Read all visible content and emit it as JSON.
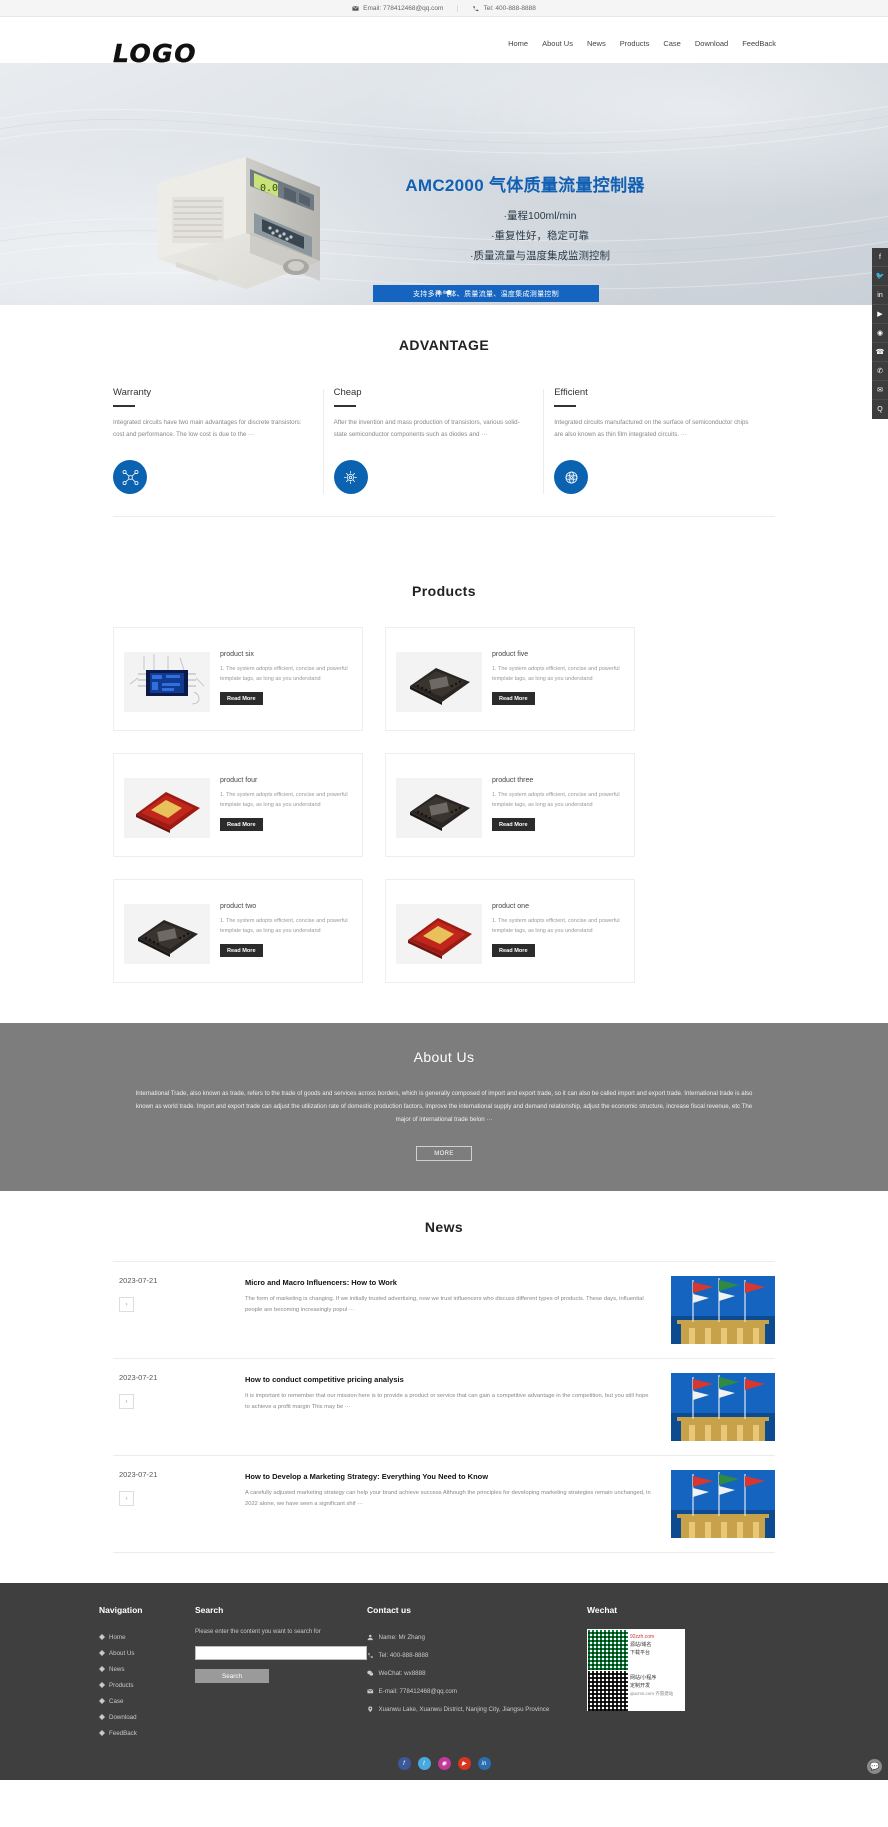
{
  "topbar": {
    "email_label": "Email: 778412468@qq.com",
    "tel_label": "Tel: 400-888-8888",
    "email_icon": "envelope-icon",
    "tel_icon": "phone-icon"
  },
  "header": {
    "logo_text": "LOGO",
    "nav": [
      {
        "label": "Home"
      },
      {
        "label": "About Us"
      },
      {
        "label": "News"
      },
      {
        "label": "Products"
      },
      {
        "label": "Case"
      },
      {
        "label": "Download"
      },
      {
        "label": "FeedBack"
      }
    ]
  },
  "hero": {
    "title": "AMC2000 气体质量流量控制器",
    "bullets": [
      "·量程100ml/min",
      "·重复性好，稳定可靠",
      "·质量流量与温度集成监测控制"
    ],
    "cta_label": "支持多种气体、质量流量、温度集成测量控制",
    "accent_color": "#1260b4",
    "cta_bg": "#1565c0",
    "slide_count": 2,
    "active_slide": 2
  },
  "social_rail": [
    {
      "name": "facebook",
      "glyph": "f"
    },
    {
      "name": "twitter",
      "glyph": "🐦"
    },
    {
      "name": "linkedin",
      "glyph": "in"
    },
    {
      "name": "youtube",
      "glyph": "▶"
    },
    {
      "name": "instagram",
      "glyph": "◉"
    },
    {
      "name": "phone",
      "glyph": "☎"
    },
    {
      "name": "whatsapp",
      "glyph": "✆"
    },
    {
      "name": "email",
      "glyph": "✉"
    },
    {
      "name": "qq",
      "glyph": "Q"
    }
  ],
  "advantage": {
    "title": "ADVANTAGE",
    "cards": [
      {
        "heading": "Warranty",
        "body": "Integrated circuits have two main advantages for discrete transistors: cost and performance. The low cost is due to the ···",
        "icon": "molecule-icon"
      },
      {
        "heading": "Cheap",
        "body": "After the invention and mass production of transistors, various solid-state semiconductor components such as diodes and ···",
        "icon": "gear-network-icon"
      },
      {
        "heading": "Efficient",
        "body": "Integrated circuits manufactured on the surface of semiconductor chips are also known as thin film integrated circuits. ···",
        "icon": "atom-icon"
      }
    ]
  },
  "products": {
    "title": "Products",
    "read_more_label": "Read More",
    "items": [
      {
        "name": "product six",
        "desc": "1. The system adopts efficient, concise and powerful template tags, as long as you understand",
        "thumb": "chip-blue-die-icon"
      },
      {
        "name": "product five",
        "desc": "1. The system adopts efficient, concise and powerful template tags, as long as you understand",
        "thumb": "chip-dark-bga-icon"
      },
      {
        "name": "product four",
        "desc": "1. The system adopts efficient, concise and powerful template tags, as long as you understand",
        "thumb": "chip-red-gold-icon"
      },
      {
        "name": "product three",
        "desc": "1. The system adopts efficient, concise and powerful template tags, as long as you understand",
        "thumb": "chip-dark-bga-icon"
      },
      {
        "name": "product two",
        "desc": "1. The system adopts efficient, concise and powerful template tags, as long as you understand",
        "thumb": "chip-dark-bga-icon"
      },
      {
        "name": "product one",
        "desc": "1. The system adopts efficient, concise and powerful template tags, as long as you understand",
        "thumb": "chip-red-gold-icon"
      }
    ]
  },
  "about": {
    "title": "About Us",
    "body": "International Trade, also known as trade, refers to the trade of goods and services across borders, which is generally composed of import and export trade, so it can also be called import and export trade. International trade is also known as world trade. Import and export trade can adjust the utilization rate of domestic production factors, improve the international supply and demand relationship, adjust the economic structure, increase fiscal revenue, etc The major of international trade belon ···",
    "more_label": "MORE",
    "bg_color": "#7d7d7d"
  },
  "news": {
    "title": "News",
    "items": [
      {
        "date": "2023-07-21",
        "title": "Micro and Macro Influencers: How to Work",
        "summary": "The form of marketing is changing. If we initially trusted advertising, now we trust influencers who discuss different types of products. These days, influential people are becoming increasingly popul ···",
        "arrow": "›"
      },
      {
        "date": "2023-07-21",
        "title": "How to conduct competitive pricing analysis",
        "summary": "It is important to remember that our mission here is to provide a product or service that can gain a competitive advantage in the competition, but you still hope to achieve a profit margin This may be ···",
        "arrow": "›"
      },
      {
        "date": "2023-07-21",
        "title": "How to Develop a Marketing Strategy: Everything You Need to Know",
        "summary": "A carefully adjusted marketing strategy can help your brand achieve success Although the principles for developing marketing strategies remain unchanged, in 2022 alone, we have seen a significant shif ···",
        "arrow": "›"
      }
    ]
  },
  "footer": {
    "nav_heading": "Navigation",
    "nav_items": [
      {
        "label": "Home"
      },
      {
        "label": "About Us"
      },
      {
        "label": "News"
      },
      {
        "label": "Products"
      },
      {
        "label": "Case"
      },
      {
        "label": "Download"
      },
      {
        "label": "FeedBack"
      }
    ],
    "search_heading": "Search",
    "search_label": "Please enter the content you want to search for",
    "search_value": "",
    "search_placeholder": "",
    "search_button": "Search",
    "contact_heading": "Contact us",
    "contact_items": [
      {
        "icon": "user-icon",
        "text": "Name: Mr Zhang"
      },
      {
        "icon": "phone-icon",
        "text": "Tel: 400-888-8888"
      },
      {
        "icon": "wechat-icon",
        "text": "WeChat: wx8888"
      },
      {
        "icon": "mail-icon",
        "text": "E-mail: 778412468@qq.com"
      },
      {
        "icon": "pin-icon",
        "text": "Xuanwu Lake, Xuanwu District, Nanjing City, Jiangsu Province"
      }
    ],
    "wechat_heading": "Wechat",
    "qr_top": {
      "line1": "92zzh.com",
      "line2": "源站/域名",
      "line3": "下载平台"
    },
    "qr_bottom": {
      "line1": "网站/小程序",
      "line2": "定制开发",
      "line3": "qiucms.com  齐雷建站"
    },
    "social": [
      {
        "name": "facebook",
        "glyph": "f",
        "color": "#3b5998"
      },
      {
        "name": "twitter",
        "glyph": "t",
        "color": "#4aa8e0"
      },
      {
        "name": "instagram",
        "glyph": "◉",
        "color": "#c1399a"
      },
      {
        "name": "youtube",
        "glyph": "▶",
        "color": "#d9341f"
      },
      {
        "name": "linkedin",
        "glyph": "in",
        "color": "#2a6db0"
      }
    ],
    "chat_glyph": "💬"
  }
}
